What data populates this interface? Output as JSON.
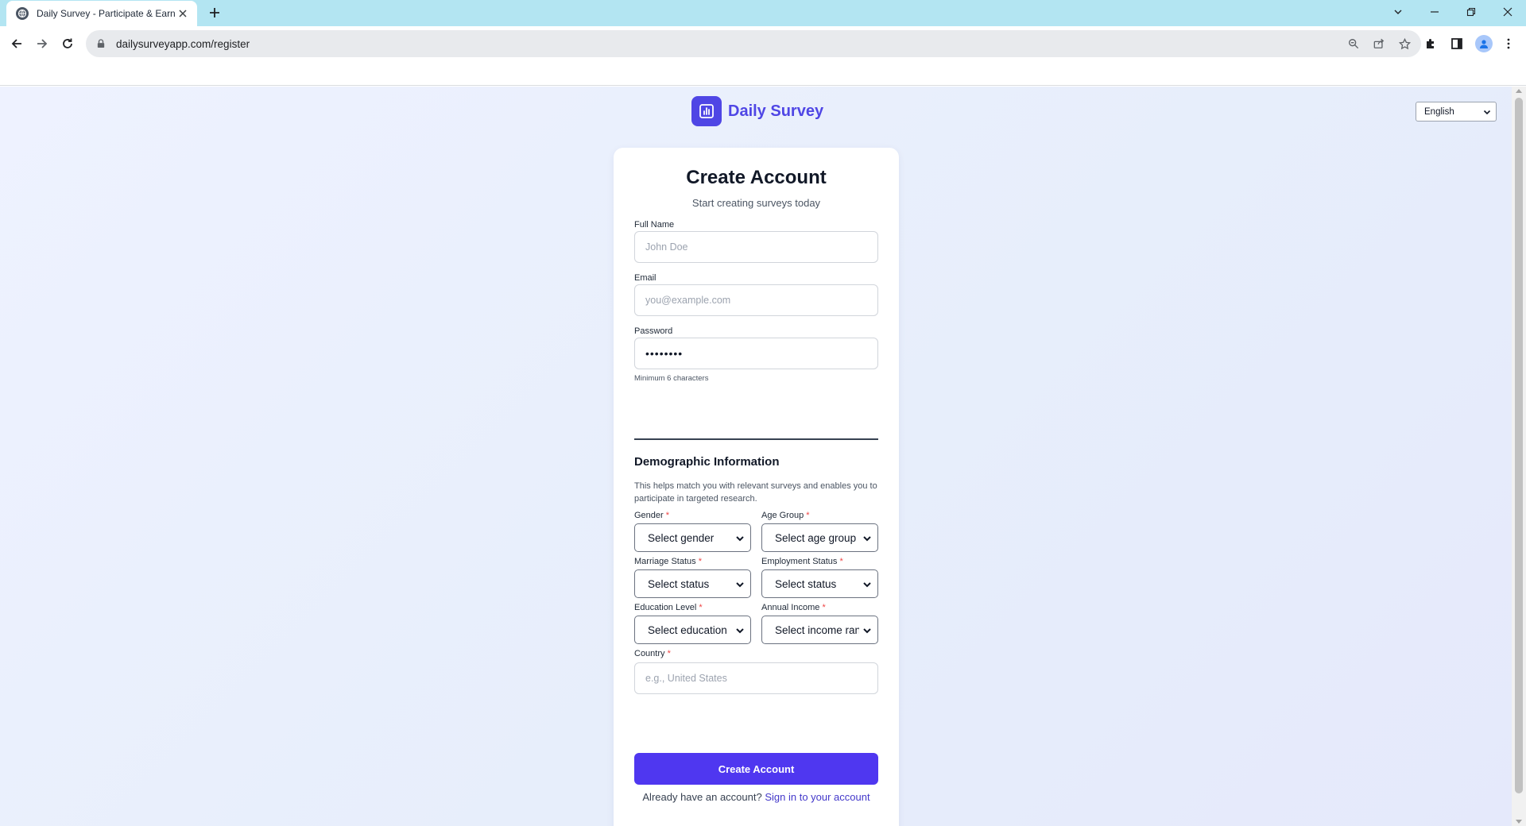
{
  "browser": {
    "tab_title": "Daily Survey - Participate & Earn",
    "url": "dailysurveyapp.com/register"
  },
  "brand": {
    "name": "Daily Survey",
    "color": "#4f46e5"
  },
  "language_select": {
    "value": "English"
  },
  "form": {
    "title": "Create Account",
    "subtitle": "Start creating surveys today",
    "full_name": {
      "label": "Full Name",
      "placeholder": "John Doe"
    },
    "email": {
      "label": "Email",
      "placeholder": "you@example.com"
    },
    "password": {
      "label": "Password",
      "value": "••••••••",
      "hint": "Minimum 6 characters"
    },
    "demographics": {
      "title": "Demographic Information",
      "description": "This helps match you with relevant surveys and enables you to participate in targeted research.",
      "required_mark": "*",
      "gender": {
        "label": "Gender",
        "value": "Select gender"
      },
      "age_group": {
        "label": "Age Group",
        "value": "Select age group"
      },
      "marriage_status": {
        "label": "Marriage Status",
        "value": "Select status"
      },
      "employment_status": {
        "label": "Employment Status",
        "value": "Select status"
      },
      "education_level": {
        "label": "Education Level",
        "value": "Select education"
      },
      "annual_income": {
        "label": "Annual Income",
        "value": "Select income range"
      },
      "country": {
        "label": "Country",
        "placeholder": "e.g., United States"
      }
    },
    "submit_label": "Create Account",
    "signin_prompt": "Already have an account?",
    "signin_link": "Sign in to your account"
  },
  "colors": {
    "accent": "#4f37f0",
    "required": "#ef4444",
    "tab_strip": "#b3e5f2"
  },
  "icons": {
    "favicon": "globe-icon",
    "logo": "bar-chart-icon"
  }
}
